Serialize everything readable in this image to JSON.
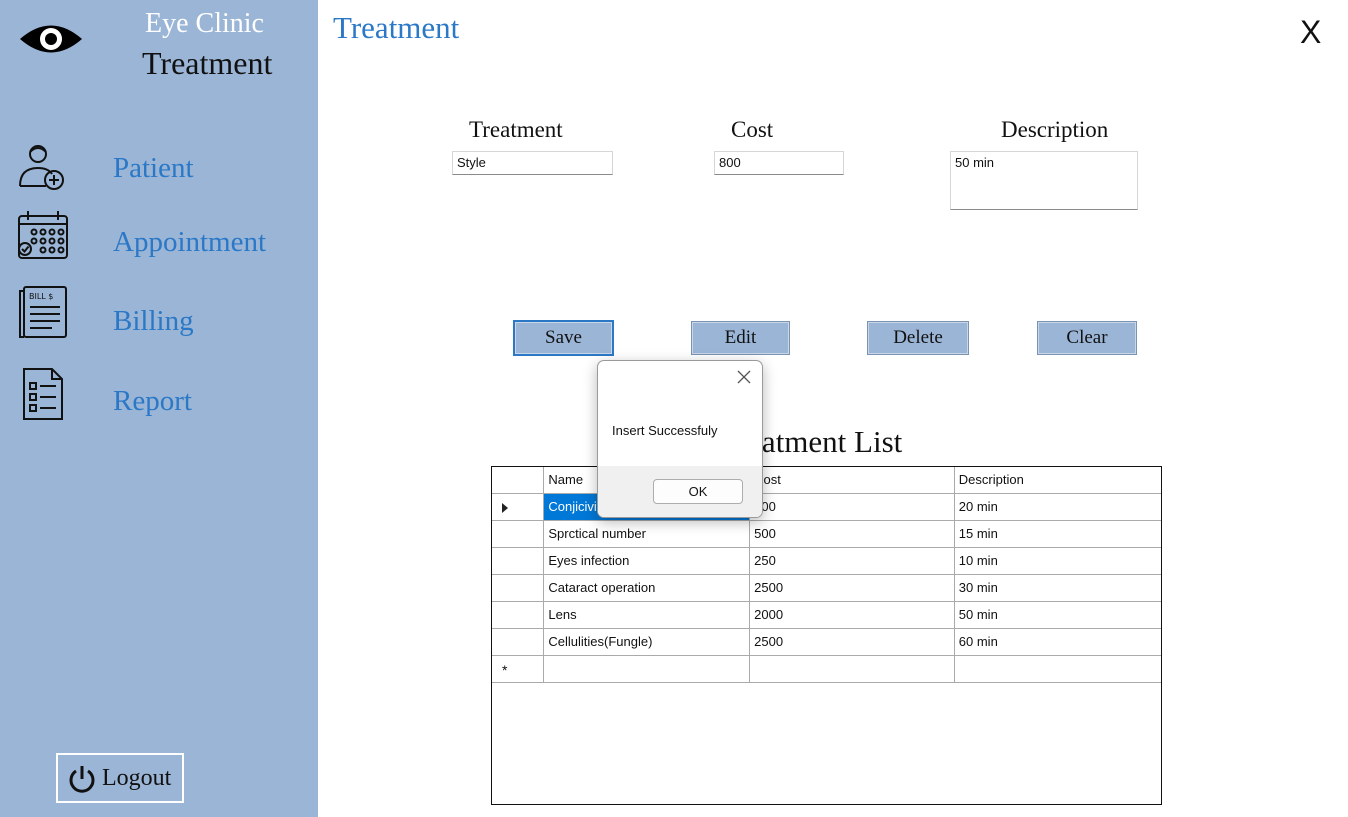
{
  "sidebar": {
    "brand_title": "Eye Clinic",
    "brand_subtitle": "Treatment",
    "nav": [
      {
        "label": "Patient",
        "icon": "patient-add-icon"
      },
      {
        "label": "Appointment",
        "icon": "calendar-icon"
      },
      {
        "label": "Billing",
        "icon": "bill-icon"
      },
      {
        "label": "Report",
        "icon": "report-icon"
      }
    ],
    "bill_icon_text": "BILL $",
    "logout_label": "Logout"
  },
  "header": {
    "title": "Treatment",
    "close_label": "X"
  },
  "form": {
    "treatment_label": "Treatment",
    "cost_label": "Cost",
    "description_label": "Description",
    "treatment_value": "Style",
    "cost_value": "800",
    "description_value": "50 min"
  },
  "buttons": {
    "save": "Save",
    "edit": "Edit",
    "delete": "Delete",
    "clear": "Clear"
  },
  "list": {
    "title": "Treatment List",
    "columns": [
      "Name",
      "Cost",
      "Description"
    ],
    "rows": [
      [
        "Conjicivitis",
        "700",
        "20 min"
      ],
      [
        "Sprctical number",
        "500",
        "15 min"
      ],
      [
        "Eyes infection",
        "250",
        "10 min"
      ],
      [
        "Cataract operation",
        "2500",
        "30 min"
      ],
      [
        "Lens",
        "2000",
        "50 min"
      ],
      [
        "Cellulities(Fungle)",
        "2500",
        "60 min"
      ]
    ],
    "new_row_marker": "*"
  },
  "dialog": {
    "message": "Insert Successfuly",
    "ok_label": "OK"
  },
  "colors": {
    "sidebar": "#9bb5d6",
    "accent": "#2a78c6",
    "selection": "#0078d7"
  }
}
